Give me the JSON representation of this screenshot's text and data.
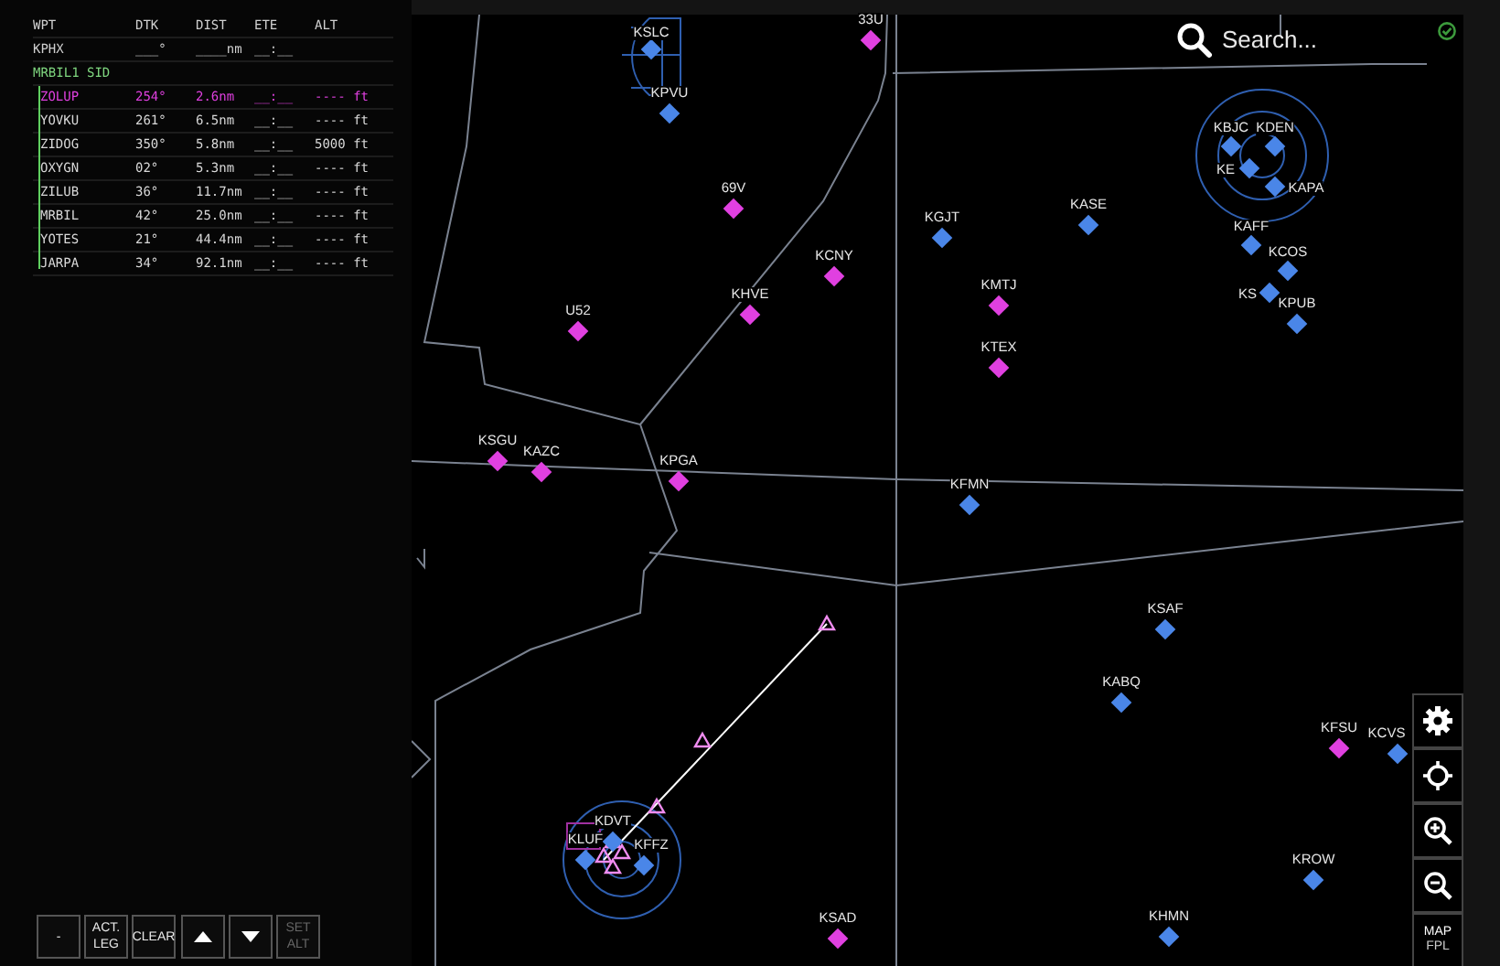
{
  "flight_plan": {
    "columns": [
      "WPT",
      "DTK",
      "DIST",
      "ETE",
      "ALT"
    ],
    "origin": {
      "wpt": "KPHX",
      "dtk": "___°",
      "dist": "____nm",
      "ete": "__:__"
    },
    "procedure": "MRBIL1 SID",
    "legs": [
      {
        "wpt": "ZOLUP",
        "dtk": "254°",
        "dist": "2.6nm",
        "ete": "__:__",
        "alt": "---- ft",
        "active": true
      },
      {
        "wpt": "YOVKU",
        "dtk": "261°",
        "dist": "6.5nm",
        "ete": "__:__",
        "alt": "---- ft",
        "active": false
      },
      {
        "wpt": "ZIDOG",
        "dtk": "350°",
        "dist": "5.8nm",
        "ete": "__:__",
        "alt": "5000 ft",
        "active": false
      },
      {
        "wpt": "OXYGN",
        "dtk": "02°",
        "dist": "5.3nm",
        "ete": "__:__",
        "alt": "---- ft",
        "active": false
      },
      {
        "wpt": "ZILUB",
        "dtk": "36°",
        "dist": "11.7nm",
        "ete": "__:__",
        "alt": "---- ft",
        "active": false
      },
      {
        "wpt": "MRBIL",
        "dtk": "42°",
        "dist": "25.0nm",
        "ete": "__:__",
        "alt": "---- ft",
        "active": false
      },
      {
        "wpt": "YOTES",
        "dtk": "21°",
        "dist": "44.4nm",
        "ete": "__:__",
        "alt": "---- ft",
        "active": false
      },
      {
        "wpt": "JARPA",
        "dtk": "34°",
        "dist": "92.1nm",
        "ete": "__:__",
        "alt": "---- ft",
        "active": false
      }
    ]
  },
  "bottom_buttons": [
    {
      "kind": "text",
      "label": "-",
      "disabled": false
    },
    {
      "kind": "text",
      "label": "ACT. LEG",
      "disabled": false
    },
    {
      "kind": "text",
      "label": "CLEAR",
      "disabled": false
    },
    {
      "kind": "up"
    },
    {
      "kind": "down"
    },
    {
      "kind": "text",
      "label": "SET ALT",
      "disabled": true
    }
  ],
  "search": {
    "placeholder": "Search..."
  },
  "airports": [
    {
      "label": "33U",
      "color": "#e040e0"
    },
    {
      "label": "KSLC",
      "color": "#4a86e8"
    },
    {
      "label": "KPVU",
      "color": "#4a86e8"
    },
    {
      "label": "KBJC",
      "color": "#4a86e8"
    },
    {
      "label": "KDEN",
      "color": "#4a86e8"
    },
    {
      "label": "KE",
      "color": "#4a86e8"
    },
    {
      "label": "KAPA",
      "color": "#4a86e8"
    },
    {
      "label": "69V",
      "color": "#e040e0"
    },
    {
      "label": "KGJT",
      "color": "#4a86e8"
    },
    {
      "label": "KASE",
      "color": "#4a86e8"
    },
    {
      "label": "KAFF",
      "color": "#4a86e8"
    },
    {
      "label": "KCOS",
      "color": "#4a86e8"
    },
    {
      "label": "KS",
      "color": "#4a86e8"
    },
    {
      "label": "KCNY",
      "color": "#e040e0"
    },
    {
      "label": "KMTJ",
      "color": "#e040e0"
    },
    {
      "label": "KHVE",
      "color": "#e040e0"
    },
    {
      "label": "U52",
      "color": "#e040e0"
    },
    {
      "label": "KPUB",
      "color": "#4a86e8"
    },
    {
      "label": "KTEX",
      "color": "#e040e0"
    },
    {
      "label": "KSGU",
      "color": "#e040e0"
    },
    {
      "label": "KAZC",
      "color": "#e040e0"
    },
    {
      "label": "KPGA",
      "color": "#e040e0"
    },
    {
      "label": "KFMN",
      "color": "#4a86e8"
    },
    {
      "label": "KSAF",
      "color": "#4a86e8"
    },
    {
      "label": "KABQ",
      "color": "#4a86e8"
    },
    {
      "label": "KFSU",
      "color": "#e040e0"
    },
    {
      "label": "KCVS",
      "color": "#4a86e8"
    },
    {
      "label": "KDVT",
      "color": "#4a86e8"
    },
    {
      "label": "KLUF",
      "color": "#4a86e8"
    },
    {
      "label": "KFFZ",
      "color": "#4a86e8"
    },
    {
      "label": "KSAD",
      "color": "#e040e0"
    },
    {
      "label": "KROW",
      "color": "#4a86e8"
    },
    {
      "label": "KHMN",
      "color": "#4a86e8"
    }
  ],
  "map_controls": [
    {
      "kind": "settings"
    },
    {
      "kind": "recenter"
    },
    {
      "kind": "zoom_in"
    },
    {
      "kind": "zoom_out"
    },
    {
      "kind": "toggle",
      "label": "MAP",
      "sublabel": "FPL"
    }
  ]
}
